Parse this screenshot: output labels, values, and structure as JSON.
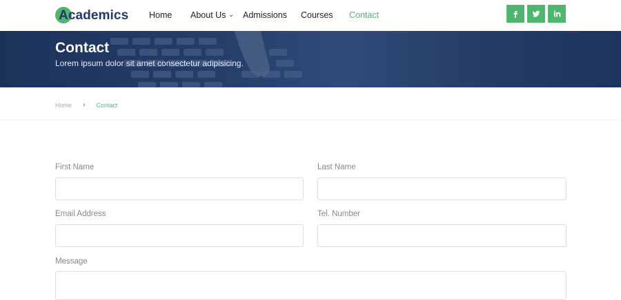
{
  "brand": {
    "logo_text": "Academics",
    "accent": "#4fb56f",
    "navy": "#25366a"
  },
  "nav": {
    "items": [
      {
        "label": "Home",
        "active": false,
        "has_dropdown": false
      },
      {
        "label": "About Us",
        "active": false,
        "has_dropdown": true
      },
      {
        "label": "Admissions",
        "active": false,
        "has_dropdown": false
      },
      {
        "label": "Courses",
        "active": false,
        "has_dropdown": false
      },
      {
        "label": "Contact",
        "active": true,
        "has_dropdown": false
      }
    ],
    "social": [
      {
        "icon": "facebook-icon",
        "glyph": "f"
      },
      {
        "icon": "twitter-icon",
        "glyph": "t"
      },
      {
        "icon": "linkedin-icon",
        "glyph": "in"
      }
    ]
  },
  "hero": {
    "title": "Contact",
    "subtitle": "Lorem ipsum dolor sit amet consectetur adipisicing."
  },
  "breadcrumb": {
    "home": "Home",
    "separator": "›",
    "current": "Contact"
  },
  "form": {
    "first_name": {
      "label": "First Name",
      "value": "",
      "placeholder": ""
    },
    "last_name": {
      "label": "Last Name",
      "value": "",
      "placeholder": ""
    },
    "email": {
      "label": "Email Address",
      "value": "",
      "placeholder": ""
    },
    "phone": {
      "label": "Tel. Number",
      "value": "",
      "placeholder": ""
    },
    "message": {
      "label": "Message",
      "value": "",
      "placeholder": ""
    }
  }
}
